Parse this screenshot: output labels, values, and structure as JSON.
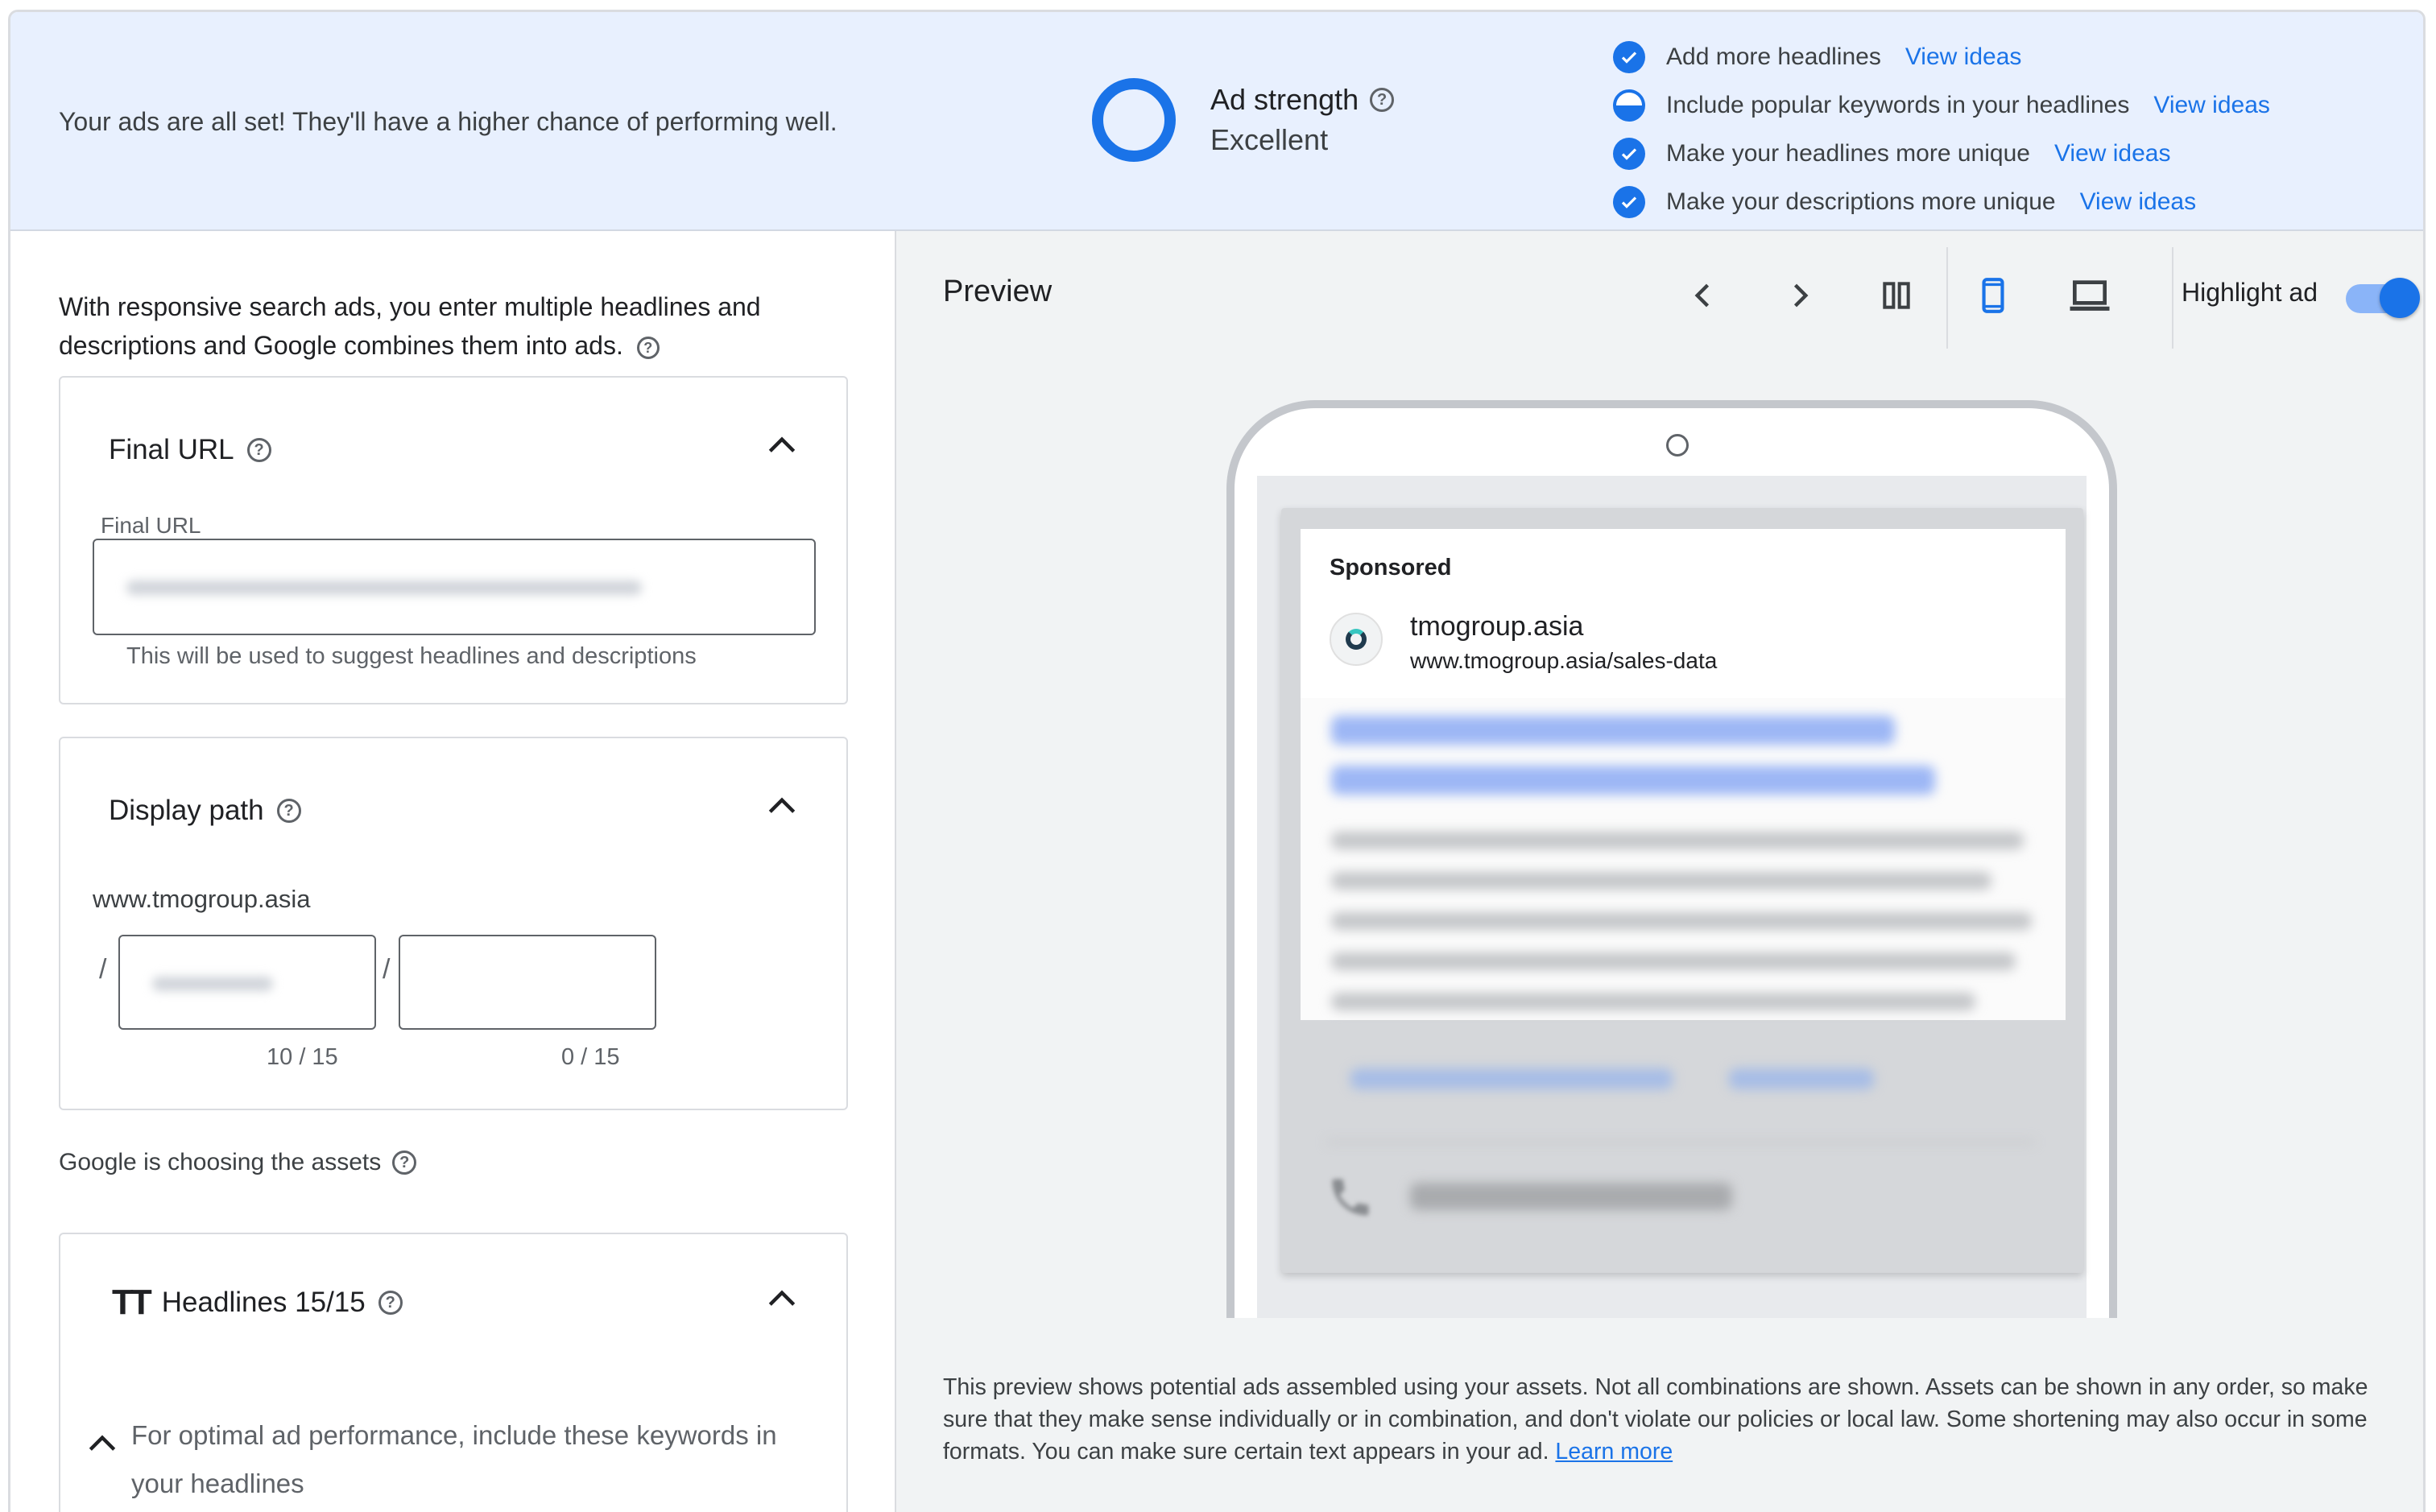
{
  "banner": {
    "message": "Your ads are all set! They'll have a higher chance of performing well.",
    "strength_label": "Ad strength",
    "strength_value": "Excellent",
    "tips": [
      {
        "text": "Add more headlines",
        "link": "View ideas",
        "status": "complete"
      },
      {
        "text": "Include popular keywords in your headlines",
        "link": "View ideas",
        "status": "partial"
      },
      {
        "text": "Make your headlines more unique",
        "link": "View ideas",
        "status": "complete"
      },
      {
        "text": "Make your descriptions more unique",
        "link": "View ideas",
        "status": "complete"
      }
    ]
  },
  "left": {
    "intro": "With responsive search ads, you enter multiple headlines and descriptions and Google combines them into ads.",
    "final_url": {
      "title": "Final URL",
      "field_label": "Final URL",
      "hint": "This will be used to suggest headlines and descriptions"
    },
    "display_path": {
      "title": "Display path",
      "domain": "www.tmogroup.asia",
      "separator": "/",
      "path1_counter": "10 / 15",
      "path2_counter": "0 / 15"
    },
    "choosing_text": "Google is choosing the assets",
    "headlines": {
      "icon_text": "TT",
      "title": "Headlines 15/15",
      "keywords_text": "For optimal ad performance, include these keywords in your headlines"
    }
  },
  "preview": {
    "title": "Preview",
    "highlight_label": "Highlight ad",
    "highlight_on": true,
    "ad": {
      "sponsored": "Sponsored",
      "site_name": "tmogroup.asia",
      "site_url": "www.tmogroup.asia/sales-data"
    },
    "disclaimer": "This preview shows potential ads assembled using your assets. Not all combinations are shown. Assets can be shown in any order, so make sure that they make sense individually or in combination, and don't violate our policies or local law. Some shortening may also occur in some formats. You can make sure certain text appears in your ad.",
    "learn_more": "Learn more"
  },
  "colors": {
    "accent": "#1a73e8",
    "banner_bg": "#e8f0fe",
    "preview_bg": "#f1f3f4"
  }
}
